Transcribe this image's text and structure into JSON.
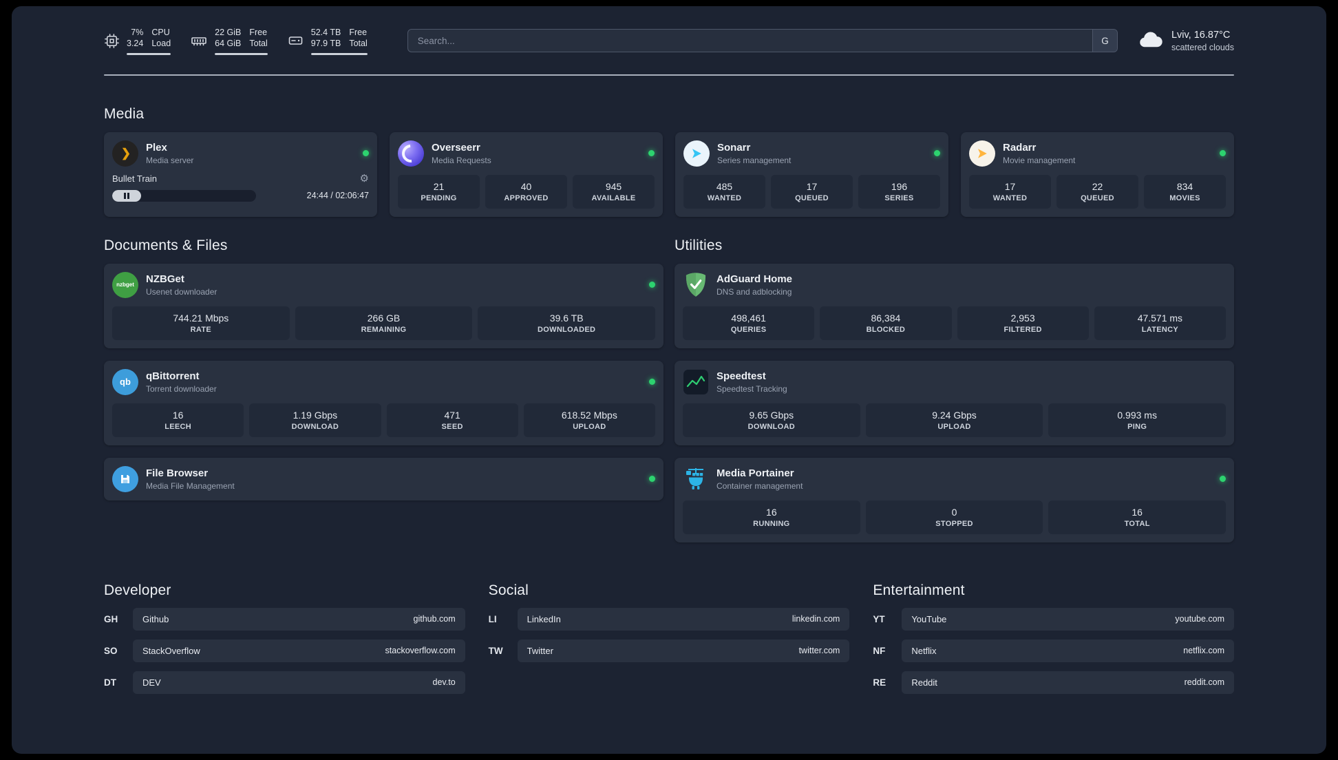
{
  "topbar": {
    "cpu": {
      "values": [
        "7%",
        "3.24"
      ],
      "labels": [
        "CPU",
        "Load"
      ]
    },
    "ram": {
      "values": [
        "22 GiB",
        "64 GiB"
      ],
      "labels": [
        "Free",
        "Total"
      ]
    },
    "disk": {
      "values": [
        "52.4 TB",
        "97.9 TB"
      ],
      "labels": [
        "Free",
        "Total"
      ]
    },
    "search": {
      "placeholder": "Search...",
      "button": "G"
    },
    "weather": {
      "location": "Lviv, 16.87°C",
      "condition": "scattered clouds"
    }
  },
  "sections": {
    "media": "Media",
    "documents": "Documents & Files",
    "utilities": "Utilities",
    "developer": "Developer",
    "social": "Social",
    "entertainment": "Entertainment"
  },
  "apps": {
    "plex": {
      "name": "Plex",
      "desc": "Media server",
      "player": {
        "title": "Bullet Train",
        "time": "24:44 / 02:06:47"
      }
    },
    "overseerr": {
      "name": "Overseerr",
      "desc": "Media Requests",
      "stats": [
        {
          "value": "21",
          "label": "PENDING"
        },
        {
          "value": "40",
          "label": "APPROVED"
        },
        {
          "value": "945",
          "label": "AVAILABLE"
        }
      ]
    },
    "sonarr": {
      "name": "Sonarr",
      "desc": "Series management",
      "stats": [
        {
          "value": "485",
          "label": "WANTED"
        },
        {
          "value": "17",
          "label": "QUEUED"
        },
        {
          "value": "196",
          "label": "SERIES"
        }
      ]
    },
    "radarr": {
      "name": "Radarr",
      "desc": "Movie management",
      "stats": [
        {
          "value": "17",
          "label": "WANTED"
        },
        {
          "value": "22",
          "label": "QUEUED"
        },
        {
          "value": "834",
          "label": "MOVIES"
        }
      ]
    },
    "nzbget": {
      "name": "NZBGet",
      "desc": "Usenet downloader",
      "icon_text": "nzbget",
      "stats": [
        {
          "value": "744.21 Mbps",
          "label": "RATE"
        },
        {
          "value": "266 GB",
          "label": "REMAINING"
        },
        {
          "value": "39.6 TB",
          "label": "DOWNLOADED"
        }
      ]
    },
    "qbittorrent": {
      "name": "qBittorrent",
      "desc": "Torrent downloader",
      "icon_text": "qb",
      "stats": [
        {
          "value": "16",
          "label": "LEECH"
        },
        {
          "value": "1.19 Gbps",
          "label": "DOWNLOAD"
        },
        {
          "value": "471",
          "label": "SEED"
        },
        {
          "value": "618.52 Mbps",
          "label": "UPLOAD"
        }
      ]
    },
    "filebrowser": {
      "name": "File Browser",
      "desc": "Media File Management"
    },
    "adguard": {
      "name": "AdGuard Home",
      "desc": "DNS and adblocking",
      "stats": [
        {
          "value": "498,461",
          "label": "QUERIES"
        },
        {
          "value": "86,384",
          "label": "BLOCKED"
        },
        {
          "value": "2,953",
          "label": "FILTERED"
        },
        {
          "value": "47.571 ms",
          "label": "LATENCY"
        }
      ]
    },
    "speedtest": {
      "name": "Speedtest",
      "desc": "Speedtest Tracking",
      "stats": [
        {
          "value": "9.65 Gbps",
          "label": "DOWNLOAD"
        },
        {
          "value": "9.24 Gbps",
          "label": "UPLOAD"
        },
        {
          "value": "0.993 ms",
          "label": "PING"
        }
      ]
    },
    "portainer": {
      "name": "Media Portainer",
      "desc": "Container management",
      "stats": [
        {
          "value": "16",
          "label": "RUNNING"
        },
        {
          "value": "0",
          "label": "STOPPED"
        },
        {
          "value": "16",
          "label": "TOTAL"
        }
      ]
    }
  },
  "bookmarks": {
    "developer": [
      {
        "abbr": "GH",
        "name": "Github",
        "url": "github.com"
      },
      {
        "abbr": "SO",
        "name": "StackOverflow",
        "url": "stackoverflow.com"
      },
      {
        "abbr": "DT",
        "name": "DEV",
        "url": "dev.to"
      }
    ],
    "social": [
      {
        "abbr": "LI",
        "name": "LinkedIn",
        "url": "linkedin.com"
      },
      {
        "abbr": "TW",
        "name": "Twitter",
        "url": "twitter.com"
      }
    ],
    "entertainment": [
      {
        "abbr": "YT",
        "name": "YouTube",
        "url": "youtube.com"
      },
      {
        "abbr": "NF",
        "name": "Netflix",
        "url": "netflix.com"
      },
      {
        "abbr": "RE",
        "name": "Reddit",
        "url": "reddit.com"
      }
    ]
  },
  "colors": {
    "accent_green": "#2dd36f",
    "page_bg": "#1c2332",
    "card_bg": "#293140"
  }
}
